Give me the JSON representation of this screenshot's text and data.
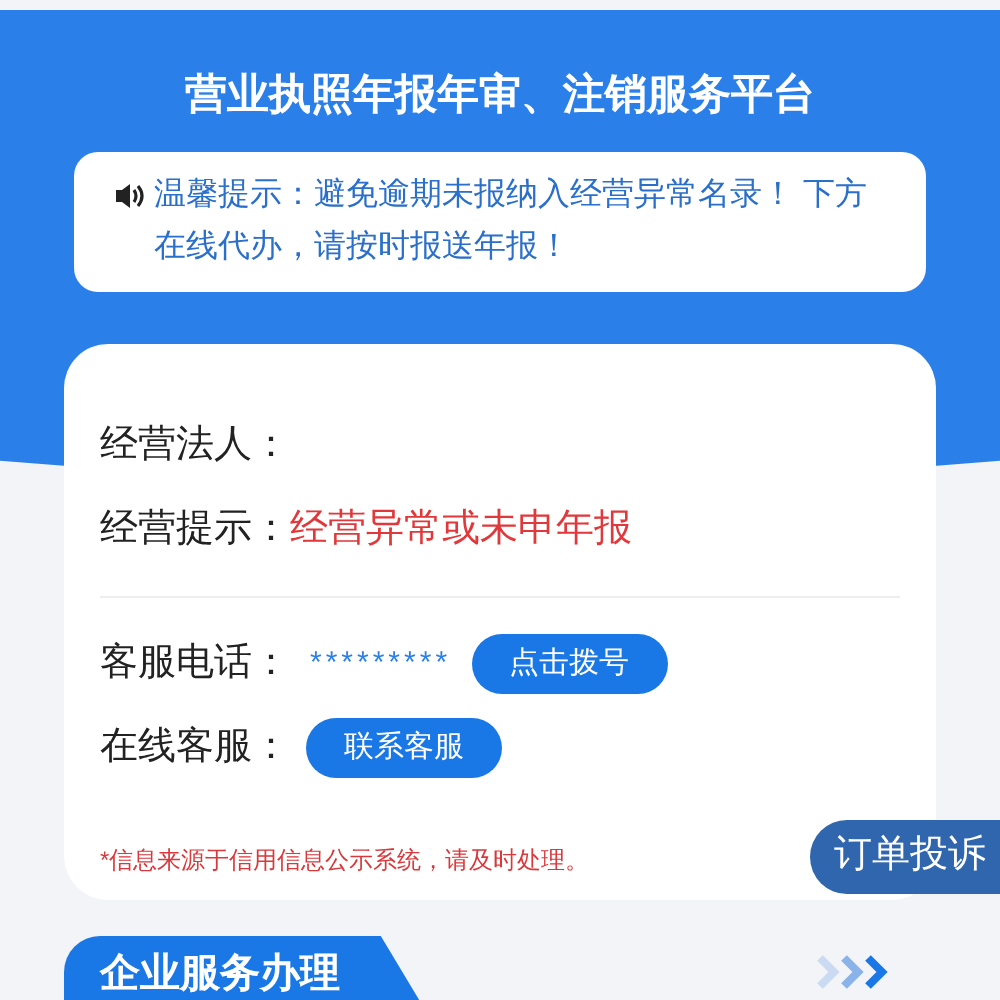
{
  "header": {
    "title": "营业执照年报年审、注销服务平台"
  },
  "notice": {
    "text": "温馨提示：避免逾期未报纳入经营异常名录！ 下方在线代办，请按时报送年报！"
  },
  "info": {
    "rows": [
      {
        "label": "经营法人：",
        "value": ""
      },
      {
        "label": "经营提示：",
        "value": "经营异常或未申年报"
      }
    ],
    "contacts": [
      {
        "label": "客服电话：",
        "value": "*********",
        "button": "点击拨号"
      },
      {
        "label": "在线客服：",
        "button": "联系客服"
      }
    ],
    "footnote": "*信息来源于信用信息公示系统，请及时处理。"
  },
  "complaint_button": "订单投诉",
  "section": {
    "title": "企业服务办理"
  }
}
